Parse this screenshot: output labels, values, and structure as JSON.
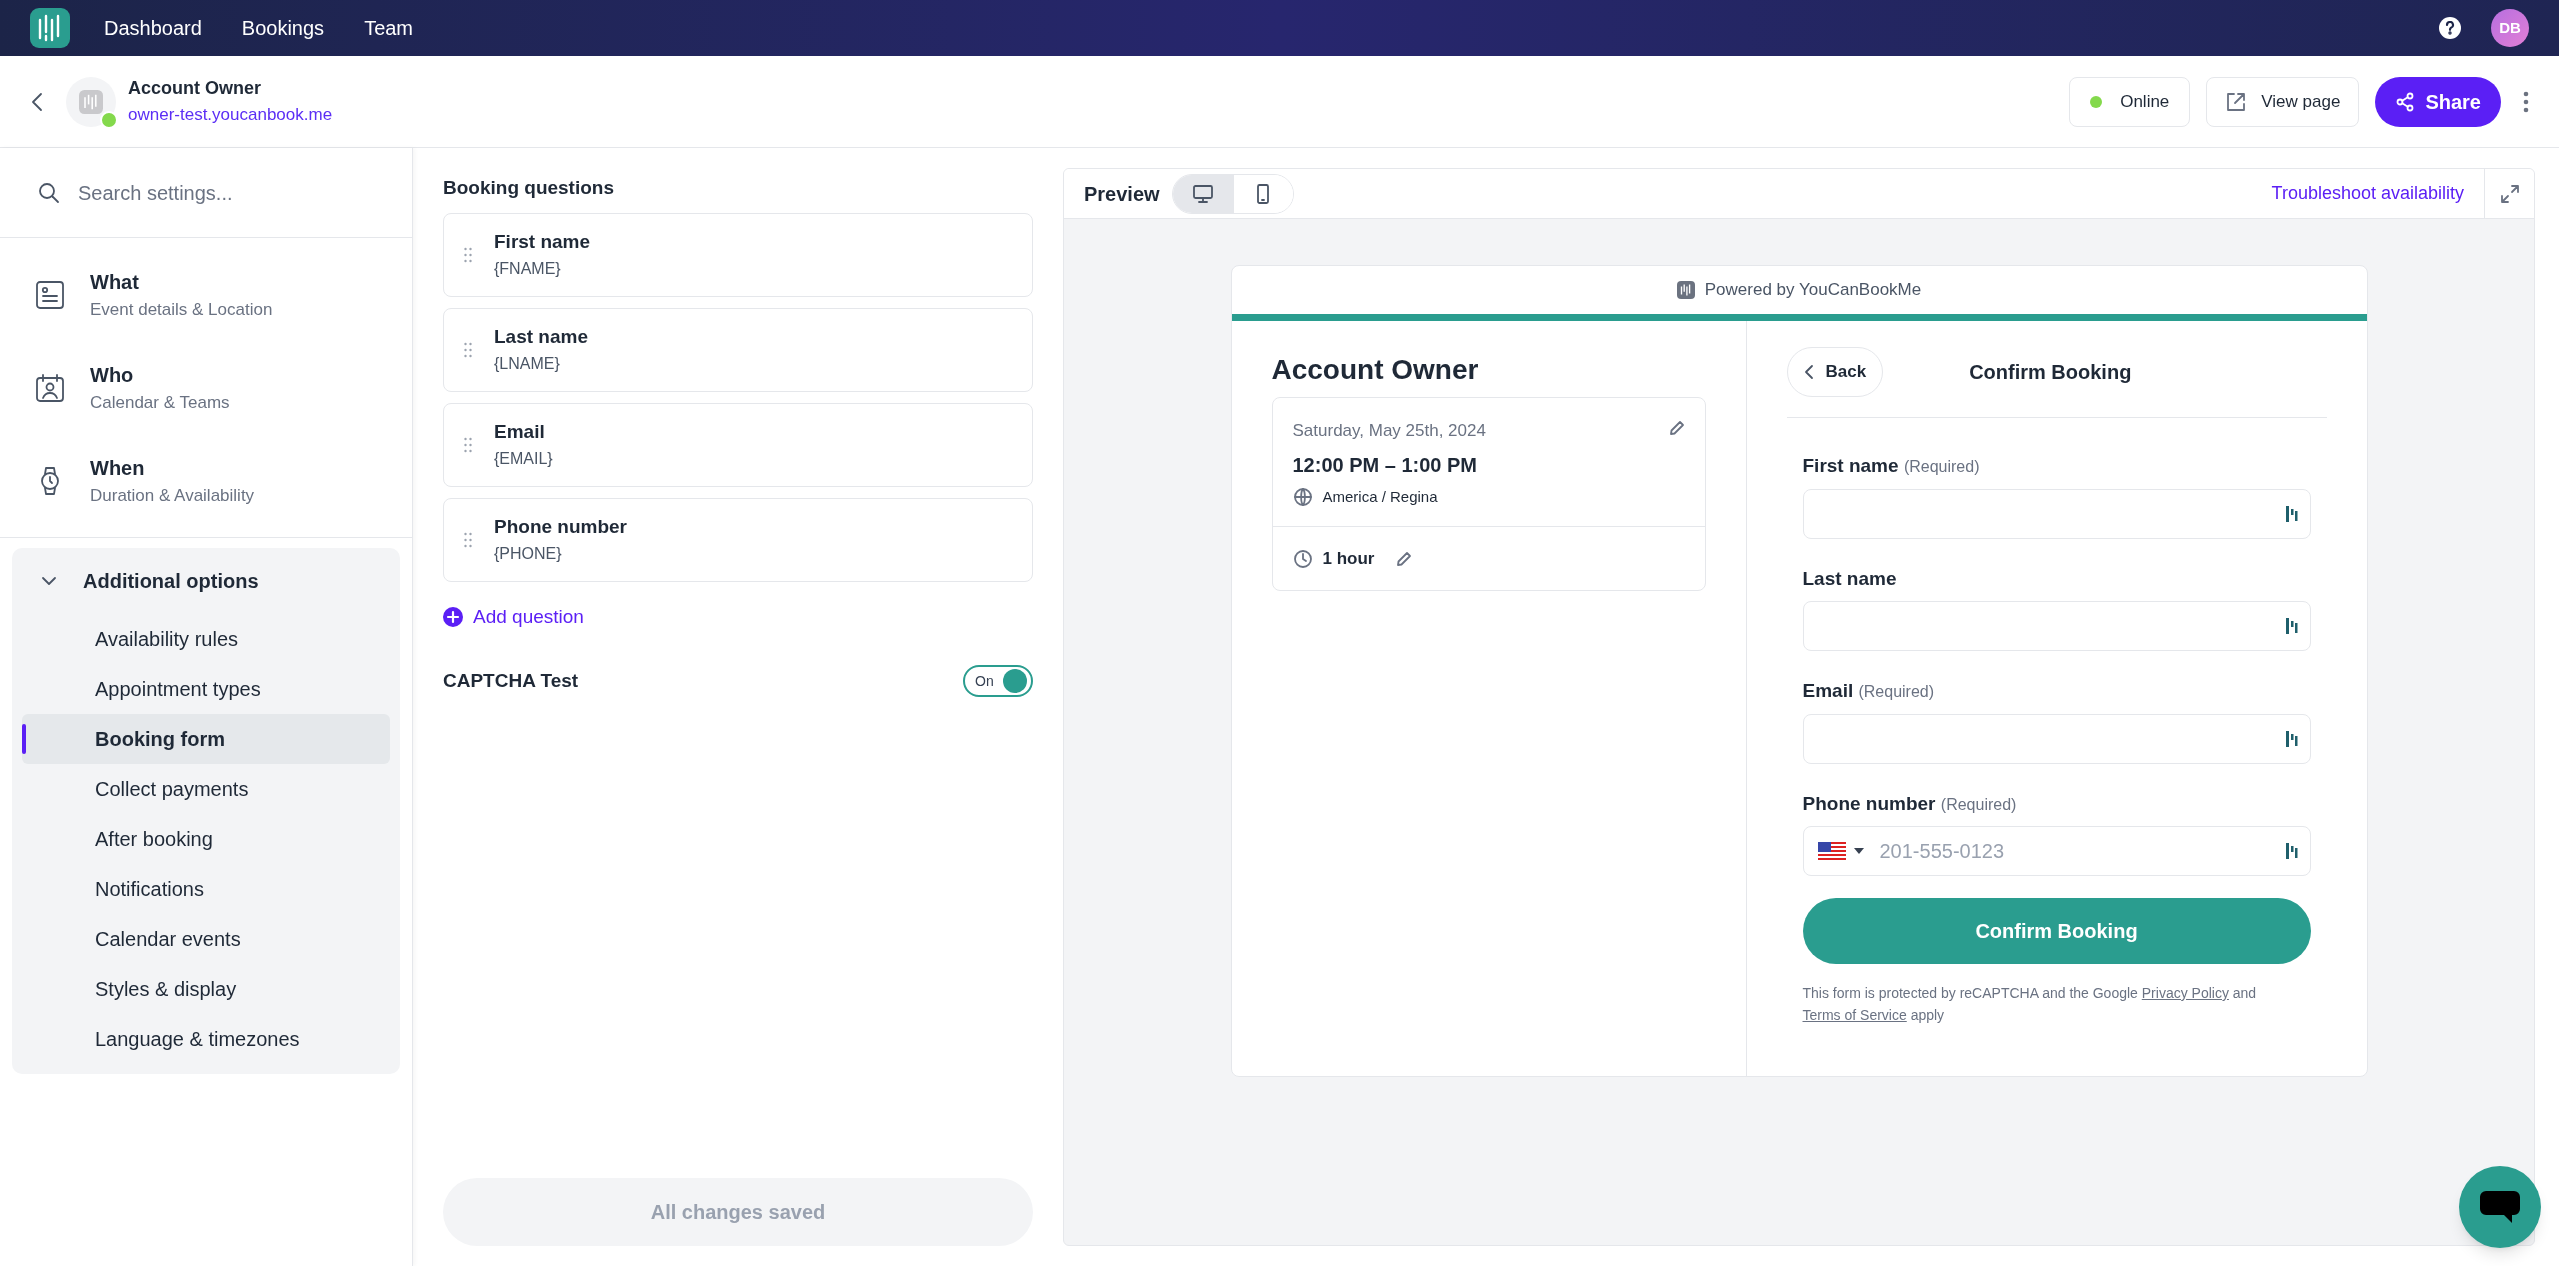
{
  "nav": {
    "links": [
      {
        "label": "Dashboard"
      },
      {
        "label": "Bookings"
      },
      {
        "label": "Team"
      }
    ],
    "avatar": "DB"
  },
  "header": {
    "title": "Account Owner",
    "url": "owner-test.youcanbook.me",
    "status": {
      "label": "Online",
      "color": "#84d94c"
    },
    "view": "View page",
    "share": "Share"
  },
  "sidebar": {
    "search": {
      "placeholder": "Search settings..."
    },
    "sections": [
      {
        "kind": "what",
        "title": "What",
        "subtitle": "Event details & Location"
      },
      {
        "kind": "who",
        "title": "Who",
        "subtitle": "Calendar & Teams"
      },
      {
        "kind": "when",
        "title": "When",
        "subtitle": "Duration & Availability"
      }
    ],
    "additional": {
      "label": "Additional options",
      "expanded": true,
      "items": [
        {
          "label": "Availability rules",
          "selected": false
        },
        {
          "label": "Appointment types",
          "selected": false
        },
        {
          "label": "Booking form",
          "selected": true
        },
        {
          "label": "Collect payments",
          "selected": false
        },
        {
          "label": "After booking",
          "selected": false
        },
        {
          "label": "Notifications",
          "selected": false
        },
        {
          "label": "Calendar events",
          "selected": false
        },
        {
          "label": "Styles & display",
          "selected": false
        },
        {
          "label": "Language & timezones",
          "selected": false
        }
      ]
    }
  },
  "questions": {
    "title": "Booking questions",
    "items": [
      {
        "label": "First name",
        "token": "{FNAME}"
      },
      {
        "label": "Last name",
        "token": "{LNAME}"
      },
      {
        "label": "Email",
        "token": "{EMAIL}"
      },
      {
        "label": "Phone number",
        "token": "{PHONE}"
      }
    ],
    "add": "Add question"
  },
  "captcha": {
    "label": "CAPTCHA Test",
    "on": true,
    "toggle_label": "On"
  },
  "save": {
    "label": "All changes saved",
    "disabled": true
  },
  "preview": {
    "title": "Preview",
    "devices": [
      {
        "kind": "desktop",
        "selected": true
      },
      {
        "kind": "mobile",
        "selected": false
      }
    ],
    "link": "Troubleshoot availability",
    "powered": "Powered by YouCanBookMe",
    "event": {
      "title": "Account Owner",
      "date": "Saturday, May 25th, 2024",
      "time": "12:00 PM – 1:00 PM",
      "timezone": "America / Regina",
      "duration": "1 hour"
    },
    "form": {
      "back": "Back",
      "title": "Confirm Booking",
      "fields": [
        {
          "kind": "text",
          "label": "First name",
          "note": "(Required)"
        },
        {
          "kind": "text",
          "label": "Last name"
        },
        {
          "kind": "text",
          "label": "Email",
          "note": "(Required)"
        },
        {
          "kind": "phone",
          "label": "Phone number",
          "note": "(Required)",
          "placeholder": "201-555-0123"
        }
      ],
      "submit": "Confirm Booking",
      "legal": {
        "before": "This form is protected by reCAPTCHA and the Google",
        "privacy": "Privacy Policy",
        "middle": "and",
        "terms": "Terms of Service",
        "after": "apply"
      }
    }
  }
}
